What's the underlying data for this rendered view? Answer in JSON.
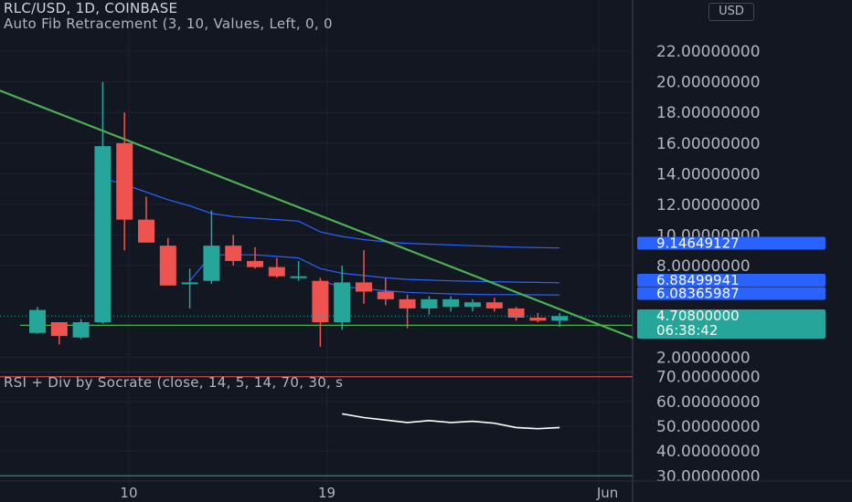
{
  "header": {
    "title": "RLC/USD, 1D, COINBASE",
    "indicator1": "Auto Fib Retracement (3, 10, Values, Left, 0, 0",
    "indicator2": "RSI + Div by Socrate (close, 14, 5, 14, 70, 30, s"
  },
  "currency_button": "USD",
  "colors": {
    "background": "#131722",
    "up": "#26a69a",
    "down": "#ef5350",
    "trendline": "#4caf50",
    "fib": "#2962ff",
    "label_blue": "#2962ff",
    "label_green": "#26a69a",
    "rsi_line": "#ffffff"
  },
  "chart_data": [
    {
      "type": "candlestick",
      "title": "RLC/USD, 1D, COINBASE",
      "y_ticks": [
        "22.00000000",
        "20.00000000",
        "18.00000000",
        "16.00000000",
        "14.00000000",
        "12.00000000",
        "10.00000000",
        "8.00000000",
        "2.00000000"
      ],
      "x_ticks": [
        "10",
        "19",
        "Jun"
      ],
      "ylim": [
        1.5,
        23.2
      ],
      "candles": [
        {
          "o": 3.6,
          "h": 5.3,
          "l": 3.55,
          "c": 5.1
        },
        {
          "o": 4.3,
          "h": 4.3,
          "l": 2.85,
          "c": 3.4
        },
        {
          "o": 3.3,
          "h": 4.5,
          "l": 3.2,
          "c": 4.3
        },
        {
          "o": 4.3,
          "h": 20.0,
          "l": 4.2,
          "c": 15.8
        },
        {
          "o": 16.0,
          "h": 18.0,
          "l": 9.0,
          "c": 11.0
        },
        {
          "o": 11.0,
          "h": 12.5,
          "l": 9.5,
          "c": 9.5
        },
        {
          "o": 9.3,
          "h": 9.8,
          "l": 6.7,
          "c": 6.7
        },
        {
          "o": 6.9,
          "h": 7.8,
          "l": 5.2,
          "c": 6.9
        },
        {
          "o": 7.0,
          "h": 11.6,
          "l": 6.8,
          "c": 9.3
        },
        {
          "o": 9.3,
          "h": 10.0,
          "l": 8.0,
          "c": 8.3
        },
        {
          "o": 8.3,
          "h": 9.2,
          "l": 7.8,
          "c": 7.9
        },
        {
          "o": 7.9,
          "h": 8.5,
          "l": 7.2,
          "c": 7.3
        },
        {
          "o": 7.3,
          "h": 8.3,
          "l": 7.0,
          "c": 7.3
        },
        {
          "o": 7.0,
          "h": 7.2,
          "l": 2.7,
          "c": 4.3
        },
        {
          "o": 4.3,
          "h": 8.0,
          "l": 3.8,
          "c": 6.9
        },
        {
          "o": 6.9,
          "h": 9.0,
          "l": 5.5,
          "c": 6.3
        },
        {
          "o": 6.3,
          "h": 7.2,
          "l": 5.4,
          "c": 5.8
        },
        {
          "o": 5.8,
          "h": 6.1,
          "l": 3.9,
          "c": 5.2
        },
        {
          "o": 5.2,
          "h": 6.0,
          "l": 4.8,
          "c": 5.8
        },
        {
          "o": 5.3,
          "h": 6.0,
          "l": 5.0,
          "c": 5.8
        },
        {
          "o": 5.3,
          "h": 5.8,
          "l": 5.0,
          "c": 5.6
        },
        {
          "o": 5.6,
          "h": 5.9,
          "l": 5.0,
          "c": 5.2
        },
        {
          "o": 5.2,
          "h": 5.3,
          "l": 4.4,
          "c": 4.6
        },
        {
          "o": 4.6,
          "h": 4.9,
          "l": 4.3,
          "c": 4.4
        },
        {
          "o": 4.4,
          "h": 4.9,
          "l": 4.0,
          "c": 4.7
        }
      ],
      "fib_levels": [
        {
          "values": [
            null,
            null,
            null,
            13.7,
            13.3,
            12.8,
            12.3,
            11.9,
            11.4,
            11.2,
            11.1,
            11.0,
            10.9,
            10.2,
            9.9,
            9.7,
            9.55,
            9.45,
            9.4,
            9.35,
            9.3,
            9.25,
            9.2,
            9.17,
            9.15
          ]
        },
        {
          "values": [
            null,
            null,
            null,
            null,
            null,
            null,
            null,
            7.0,
            8.7,
            8.7,
            8.7,
            8.6,
            8.5,
            7.8,
            7.5,
            7.35,
            7.2,
            7.1,
            7.05,
            7.0,
            6.97,
            6.95,
            6.92,
            6.9,
            6.88
          ]
        },
        {
          "values": [
            null,
            null,
            null,
            null,
            null,
            null,
            null,
            null,
            null,
            null,
            null,
            null,
            null,
            7.0,
            6.6,
            6.5,
            6.35,
            6.25,
            6.2,
            6.15,
            6.12,
            6.1,
            6.1,
            6.09,
            6.08
          ]
        }
      ],
      "trendline": {
        "from": {
          "index": -4.2,
          "value": 20.8
        },
        "to": {
          "index": 27.7,
          "value": 3.1
        }
      },
      "support_line": 4.1,
      "price_labels": [
        {
          "text": "9.14649127",
          "color": "#2962ff"
        },
        {
          "text": "6.88499941",
          "color": "#2962ff"
        },
        {
          "text": "6.08365987",
          "color": "#2962ff"
        },
        {
          "text": "4.70800000",
          "sub": "06:38:42",
          "color": "#26a69a"
        }
      ],
      "last_price": 4.708,
      "countdown": "06:38:42"
    },
    {
      "type": "line",
      "title": "RSI + Div by Socrate (close, 14, 5, 14, 70, 30, s",
      "y_ticks": [
        "70.00000000",
        "60.00000000",
        "50.00000000",
        "40.00000000",
        "30.00000000"
      ],
      "ylim": [
        29,
        71
      ],
      "series": [
        {
          "start_index": 14,
          "values": [
            55.0,
            53.5,
            52.5,
            51.5,
            52.3,
            51.5,
            52.0,
            51.2,
            49.5,
            49.0,
            49.5
          ]
        }
      ],
      "hlines": [
        70,
        30
      ]
    }
  ]
}
